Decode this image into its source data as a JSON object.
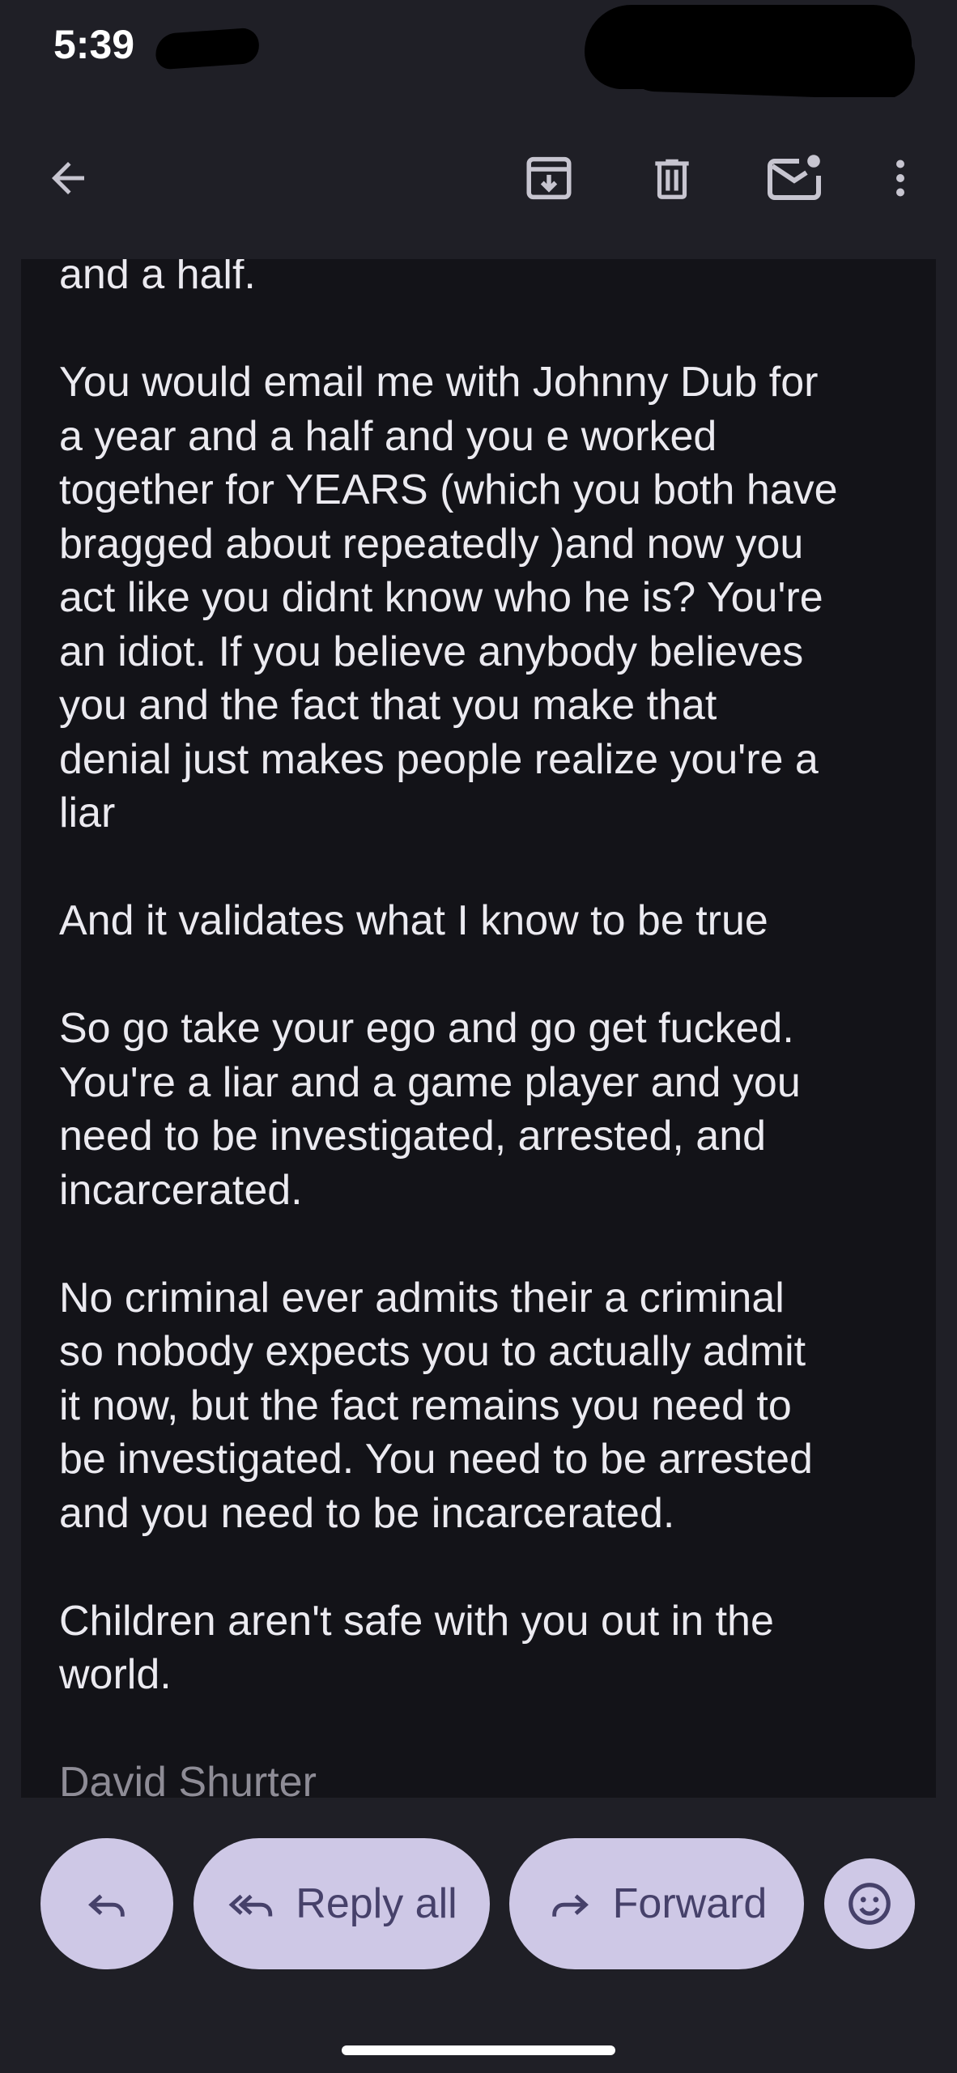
{
  "status_bar": {
    "time": "5:39"
  },
  "toolbar": {
    "back_icon": "arrow-left-icon",
    "archive_icon": "archive-icon",
    "delete_icon": "trash-icon",
    "mark_unread_icon": "mail-unread-icon",
    "more_icon": "more-vert-icon"
  },
  "message": {
    "paragraphs": [
      "and a half.",
      "You would email me with Johnny Dub for\na year and a half and you e worked\ntogether for YEARS (which you both have\nbragged about repeatedly )and now you\nact like you didnt know who he is? You're\nan idiot. If you believe anybody believes\nyou and the fact that you make that\ndenial just makes people realize you're a\nliar",
      "And it validates what I know to be true",
      "So go take your ego and go get fucked.\nYou're a liar and a game player and you\nneed to be investigated, arrested, and\nincarcerated.",
      "No criminal ever admits their a criminal\nso nobody expects you to actually admit\nit now, but the fact remains you need to\nbe investigated. You need to be arrested\nand you need to be incarcerated.",
      "Children aren't safe with you out in the\nworld."
    ],
    "signature": "David Shurter"
  },
  "actions": {
    "reply_icon": "reply-icon",
    "reply_all_label": "Reply all",
    "reply_all_icon": "reply-all-icon",
    "forward_label": "Forward",
    "forward_icon": "forward-icon",
    "emoji_icon": "emoji-icon"
  },
  "colors": {
    "background": "#1f1f26",
    "message_background": "#131318",
    "text": "#ebeaf0",
    "pill": "#cec8e6",
    "pill_text": "#46416a"
  }
}
